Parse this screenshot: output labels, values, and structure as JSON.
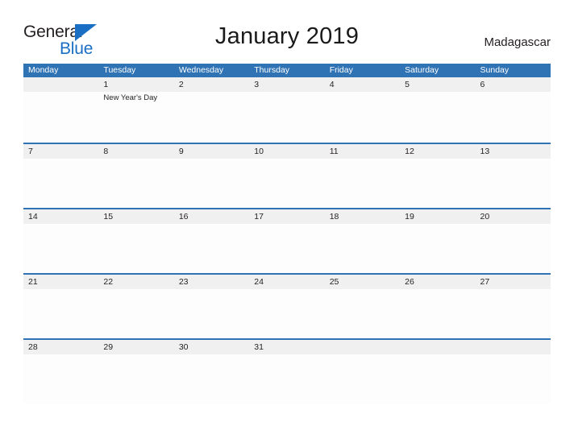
{
  "logo": {
    "text_top": "General",
    "text_bottom": "Blue",
    "triangle_icon": "triangle-icon",
    "color_blue": "#1a6fc4",
    "color_dark": "#231f20"
  },
  "header": {
    "title": "January 2019",
    "country": "Madagascar"
  },
  "theme": {
    "header_blue": "#2f73b4",
    "band_gray": "#f0f0f0",
    "cell_white": "#fdfdfd",
    "text_dark": "#231f20",
    "text_white": "#ffffff"
  },
  "calendar": {
    "weekdays": [
      "Monday",
      "Tuesday",
      "Wednesday",
      "Thursday",
      "Friday",
      "Saturday",
      "Sunday"
    ],
    "weeks": [
      [
        {
          "date": "",
          "event": ""
        },
        {
          "date": "1",
          "event": "New Year's Day"
        },
        {
          "date": "2",
          "event": ""
        },
        {
          "date": "3",
          "event": ""
        },
        {
          "date": "4",
          "event": ""
        },
        {
          "date": "5",
          "event": ""
        },
        {
          "date": "6",
          "event": ""
        }
      ],
      [
        {
          "date": "7",
          "event": ""
        },
        {
          "date": "8",
          "event": ""
        },
        {
          "date": "9",
          "event": ""
        },
        {
          "date": "10",
          "event": ""
        },
        {
          "date": "11",
          "event": ""
        },
        {
          "date": "12",
          "event": ""
        },
        {
          "date": "13",
          "event": ""
        }
      ],
      [
        {
          "date": "14",
          "event": ""
        },
        {
          "date": "15",
          "event": ""
        },
        {
          "date": "16",
          "event": ""
        },
        {
          "date": "17",
          "event": ""
        },
        {
          "date": "18",
          "event": ""
        },
        {
          "date": "19",
          "event": ""
        },
        {
          "date": "20",
          "event": ""
        }
      ],
      [
        {
          "date": "21",
          "event": ""
        },
        {
          "date": "22",
          "event": ""
        },
        {
          "date": "23",
          "event": ""
        },
        {
          "date": "24",
          "event": ""
        },
        {
          "date": "25",
          "event": ""
        },
        {
          "date": "26",
          "event": ""
        },
        {
          "date": "27",
          "event": ""
        }
      ],
      [
        {
          "date": "28",
          "event": ""
        },
        {
          "date": "29",
          "event": ""
        },
        {
          "date": "30",
          "event": ""
        },
        {
          "date": "31",
          "event": ""
        },
        {
          "date": "",
          "event": ""
        },
        {
          "date": "",
          "event": ""
        },
        {
          "date": "",
          "event": ""
        }
      ]
    ]
  }
}
